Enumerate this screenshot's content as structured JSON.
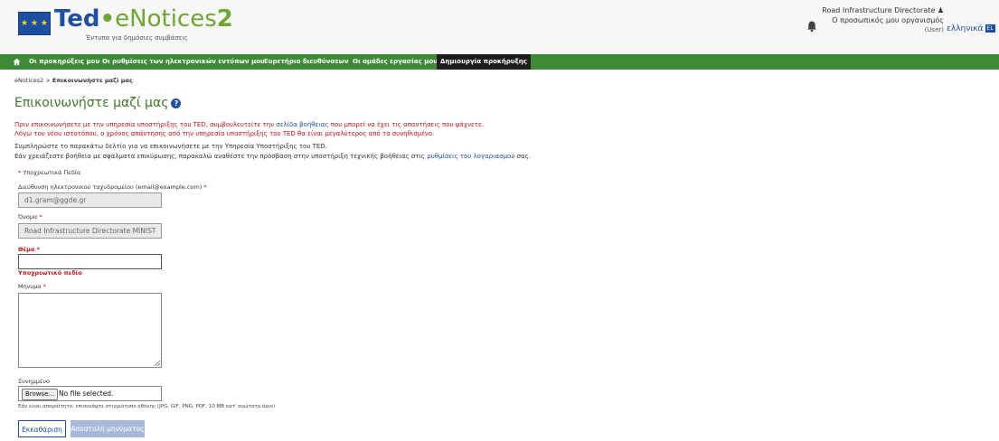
{
  "header": {
    "logo_ted": "Ted",
    "logo_dot": "•",
    "logo_enotices": "eNotices",
    "logo_two": "2",
    "logo_subtitle": "Έντυπα για δημόσιες συμβάσεις",
    "user_org": "Road Infrastructure Directorate",
    "user_profile": "Ο προσωπικός μου οργανισμός",
    "user_role": "(User)",
    "language": "ελληνικά",
    "language_badge": "EL"
  },
  "nav": {
    "items": [
      "Οι προκηρύξεις μου",
      "Οι ρυθμίσεις των ηλεκτρονικών εντύπων μου",
      "Ευρετήριο διευθύνσεων",
      "Οι ομάδες εργασίας μου",
      "Δημιουργία προκήρυξης"
    ]
  },
  "breadcrumb": {
    "root": "eNotices2",
    "separator": ">",
    "current": "Επικοινωνήστε μαζί μας"
  },
  "page": {
    "title": "Επικοινωνήστε μαζί μας",
    "warn1_pre": "Πριν επικοινωνήσετε με την υπηρεσία υποστήριξης του TED, συμβουλευτείτε την ",
    "warn1_link": "σελίδα βοήθειας",
    "warn1_post": " που μπορεί να έχει τις απαντήσεις που ψάχνετε.",
    "warn2": "Λόγω του νέου ιστοτόπου, ο χρόνος απάντησης από την υπηρεσία υποστήριξης του TED θα είναι μεγαλύτερος από το συνηθισμένο.",
    "info1": "Συμπληρώστε το παρακάτω δελτίο για να επικοινωνήσετε με την Υπηρεσία Υποστήριξης του TED.",
    "info2_pre": "Εάν χρειάζεστε βοήθεια με σφάλματα επικύρωσης, παρακαλώ αναθέστε την πρόσβαση στην υποστήριξη τεχνικής βοήθειας στις ",
    "info2_link": "ρυθμίσεις του λογαριασμού",
    "info2_post": " σας.",
    "required_legend": "Υποχρεωτικά Πεδία"
  },
  "form": {
    "email_label": "Διεύθυνση ηλεκτρονικού ταχυδρομείου (email@example.com)",
    "email_value": "d1.gram@ggde.gr",
    "name_label": "Όνομα",
    "name_value": "Road Infrastructure Directorate MINISTRY O",
    "subject_label": "Θέμα",
    "subject_value": "",
    "subject_error": "Υποχρεωτικό πεδίο",
    "message_label": "Μήνυμα",
    "attachment_label": "Συνημμένο",
    "browse_label": "Browse...",
    "no_file_text": "No file selected.",
    "attachment_hint": "Εάν είναι απαραίτητο, επισυνάψτε στιγμιότυπο οθόνης (JPG, GIF, PNG, PDF, 10 MB κατ' ανώτατο όριο)",
    "clear_button": "Εκκαθάριση",
    "send_button": "Αποστολή μηνύματος"
  },
  "colors": {
    "nav_green": "#3d8b37",
    "title_green": "#3d7a27",
    "link_blue": "#1f4fa3",
    "error_red": "#c0141c"
  }
}
